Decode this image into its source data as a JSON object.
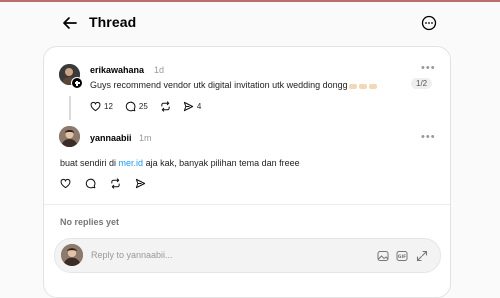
{
  "header": {
    "title": "Thread"
  },
  "post": {
    "username": "erikawahana",
    "time": "1d",
    "text": "Guys recommend vendor utk digital invitation utk wedding dongg",
    "pager": "1/2",
    "likes": "12",
    "comments": "25",
    "shares": "4"
  },
  "reply": {
    "username": "yannaabii",
    "time": "1m",
    "text_before": "buat sendiri di ",
    "link": "mer.id",
    "text_after": " aja kak, banyak pilihan tema dan freee"
  },
  "no_replies": "No replies yet",
  "reply_box": {
    "placeholder": "Reply to yannaabii..."
  },
  "colors": {
    "accent_link": "#1d9bf0",
    "top_border": "#b96f6f"
  },
  "icons": [
    "back-arrow-icon",
    "more-circle-icon",
    "heart-icon",
    "comment-icon",
    "repost-icon",
    "share-icon",
    "more-dots-icon",
    "image-icon",
    "gif-icon",
    "expand-icon"
  ]
}
